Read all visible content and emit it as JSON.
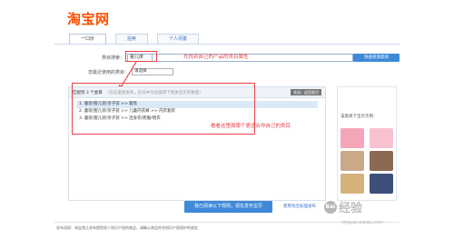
{
  "logo": {
    "text": "淘宝网",
    "color": "#ff5000"
  },
  "tabs": [
    {
      "label": "一口价",
      "active": true
    },
    {
      "label": "拍卖",
      "active": false
    },
    {
      "label": "个人闲置",
      "active": false
    }
  ],
  "category_search": {
    "label": "类目搜索：",
    "value": "婴儿床",
    "button": "快速找到类目"
  },
  "recent_categories": {
    "label": "您最近使用的类目：",
    "select_value": "请选择"
  },
  "annotations": {
    "search_hint": "先找到自己的产品的类目属性",
    "list_hint": "看看这里面哪个更适合作自己的类目"
  },
  "match_panel": {
    "title": "匹配到 3 个类目",
    "hint": "（双击直接发布，括号中为该类目下相关宝贝的数量）",
    "close_label": "关闭，返回类目",
    "items": [
      "1. 童装/婴儿装/亲子装 >> 套装",
      "2. 童装/婴儿装/亲子装 >> 儿童内衣裤 >> 内衣套装",
      "3. 童装/婴儿装/亲子装 >> 连身衣/爬服/哈衣"
    ]
  },
  "reference": {
    "label": "该类目下宝贝示例：",
    "thumbs": [
      {
        "color": "#f4a6b8"
      },
      {
        "color": "#f7c1cf"
      },
      {
        "color": "#c9a98a"
      },
      {
        "color": "#8b6a52"
      },
      {
        "color": "#d4b27c"
      },
      {
        "color": "#3c4f7a"
      }
    ]
  },
  "actions": {
    "primary": "我已阅读以下规则，现在发布宝贝",
    "secondary": "使用淘宝助理发布"
  },
  "footer": {
    "text": "发布须知：淘宝禁止发布侵犯他人知识产权的商品，请确认商品符合知识产权保护的规定"
  },
  "watermark": {
    "logo": "Bai",
    "text": "经验",
    "url": "jingyan.baidu.com"
  }
}
